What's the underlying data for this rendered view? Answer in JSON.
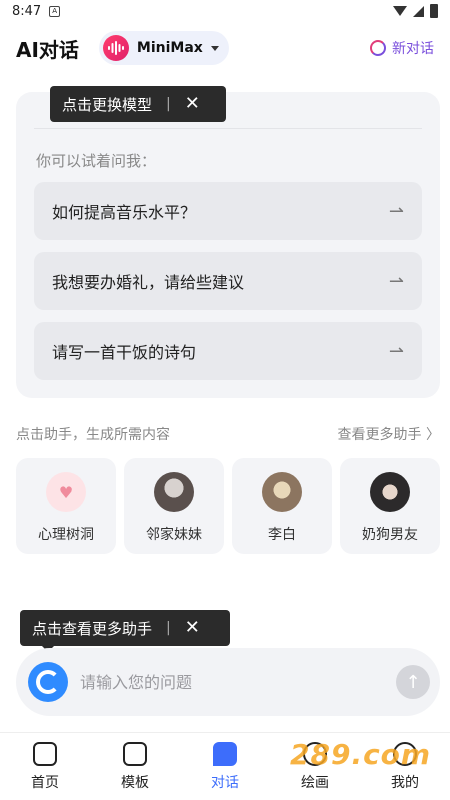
{
  "status_bar": {
    "time": "8:47",
    "notif_glyph": "A"
  },
  "header": {
    "title": "AI对话",
    "model_name": "MiniMax",
    "new_chat_label": "新对话"
  },
  "tooltips": {
    "top": {
      "text": "点击更换模型",
      "separator": "|",
      "close": "✕"
    },
    "bottom": {
      "text": "点击查看更多助手",
      "separator": "|",
      "close": "✕"
    }
  },
  "suggestions": {
    "hint": "你可以试着问我：",
    "items": [
      {
        "label": "如何提高音乐水平？",
        "arrow": "⇀"
      },
      {
        "label": "我想要办婚礼，请给些建议",
        "arrow": "⇀"
      },
      {
        "label": "请写一首干饭的诗句",
        "arrow": "⇀"
      }
    ]
  },
  "assistants": {
    "hint": "点击助手，生成所需内容",
    "more_label": "查看更多助手 〉",
    "items": [
      {
        "label": "心理树洞",
        "icon": "heart-icon"
      },
      {
        "label": "邻家妹妹",
        "icon": "girl-avatar"
      },
      {
        "label": "李白",
        "icon": "poet-avatar"
      },
      {
        "label": "奶狗男友",
        "icon": "boy-avatar"
      }
    ]
  },
  "input": {
    "placeholder": "请输入您的问题",
    "send_glyph": "↑"
  },
  "bottom_nav": {
    "items": [
      {
        "label": "首页",
        "icon": "home-icon",
        "active": false
      },
      {
        "label": "模板",
        "icon": "template-icon",
        "active": false
      },
      {
        "label": "对话",
        "icon": "chat-icon",
        "active": true
      },
      {
        "label": "绘画",
        "icon": "paint-icon",
        "active": false
      },
      {
        "label": "我的",
        "icon": "profile-icon",
        "active": false
      }
    ]
  },
  "watermark": "289.com",
  "colors": {
    "accent": "#3d6dfb",
    "new_chat": "#7a4fdc",
    "model_logo": "#e0216a"
  }
}
